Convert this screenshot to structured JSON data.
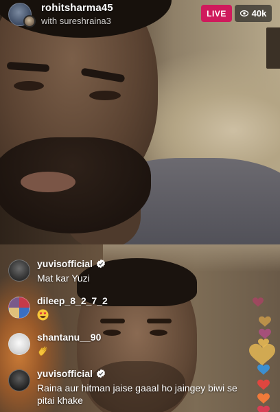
{
  "broadcast": {
    "host_username": "rohitsharma45",
    "with_line": "with sureshraina3",
    "live_label": "LIVE",
    "viewer_count": "40k"
  },
  "comments": [
    {
      "username": "yuvisofficial",
      "verified": true,
      "text": "Mat kar Yuzi"
    },
    {
      "username": "dileep_8_2_7_2",
      "verified": false,
      "text": "",
      "emoji": "heart-eyes-emoji"
    },
    {
      "username": "shantanu__90",
      "verified": false,
      "text": "",
      "emoji": "clapping-hands-emoji"
    },
    {
      "username": "yuvisofficial",
      "verified": true,
      "text": "Raina aur hitman jaise gaaal ho jaingey biwi se pitai khake"
    }
  ],
  "icons": {
    "viewers": "eye-icon",
    "verified": "verified-badge-icon",
    "reactions": "heart-icon"
  },
  "colors": {
    "live_badge": "#cf1a5c",
    "verified_badge": "#ffffff",
    "heart_colors": [
      "#c2366f",
      "#d6a24a",
      "#e3b653",
      "#3c8fd0",
      "#e0463f",
      "#e0463f",
      "#f07a3a",
      "#d63f55"
    ]
  }
}
